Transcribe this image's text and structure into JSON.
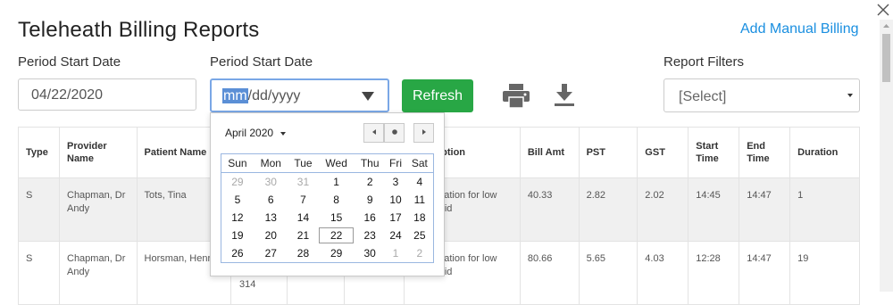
{
  "page": {
    "title": "Teleheath Billing Reports",
    "add_manual_billing": "Add Manual Billing"
  },
  "filters": {
    "start_label": "Period Start Date",
    "start_value": "04/22/2020",
    "end_label": "Period Start Date",
    "end_placeholder_mm": "mm",
    "end_placeholder_rest": "/dd/yyyy",
    "refresh_label": "Refresh",
    "report_filters_label": "Report Filters",
    "report_filters_value": "[Select]"
  },
  "table": {
    "headers": {
      "type": "Type",
      "provider": "Provider Name",
      "patient": "Patient Name",
      "description": "Description",
      "bill_amt": "Bill Amt",
      "pst": "PST",
      "gst": "GST",
      "start_time": "Start Time",
      "end_time": "End Time",
      "duration": "Duration"
    },
    "rows": [
      {
        "type": "S",
        "provider": "Chapman, Dr Andy",
        "patient": "Tots, Tina",
        "description": "Examination for low vision aid",
        "bill_amt": "40.33",
        "pst": "2.82",
        "gst": "2.02",
        "start_time": "14:45",
        "end_time": "14:47",
        "duration": "1"
      },
      {
        "type": "S",
        "provider": "Chapman, Dr Andy",
        "patient": "Horsman, Henry",
        "description": "Examination for low vision aid",
        "bill_amt": "80.66",
        "pst": "5.65",
        "gst": "4.03",
        "start_time": "12:28",
        "end_time": "14:47",
        "duration": "19"
      }
    ],
    "partial_value": "314"
  },
  "calendar": {
    "month_label": "April 2020",
    "weekdays": [
      "Sun",
      "Mon",
      "Tue",
      "Wed",
      "Thu",
      "Fri",
      "Sat"
    ],
    "weeks": [
      [
        "29",
        "30",
        "31",
        "1",
        "2",
        "3",
        "4"
      ],
      [
        "5",
        "6",
        "7",
        "8",
        "9",
        "10",
        "11"
      ],
      [
        "12",
        "13",
        "14",
        "15",
        "16",
        "17",
        "18"
      ],
      [
        "19",
        "20",
        "21",
        "22",
        "23",
        "24",
        "25"
      ],
      [
        "26",
        "27",
        "28",
        "29",
        "30",
        "1",
        "2"
      ]
    ],
    "today": "22"
  },
  "icons": [
    "close-icon",
    "printer-icon",
    "download-icon",
    "dropdown-arrow-icon",
    "chevron-left-icon",
    "circle-icon",
    "chevron-right-icon"
  ],
  "colors": {
    "accent": "#1a8fe0",
    "refresh": "#28a745",
    "selection": "#5b8fd6"
  }
}
